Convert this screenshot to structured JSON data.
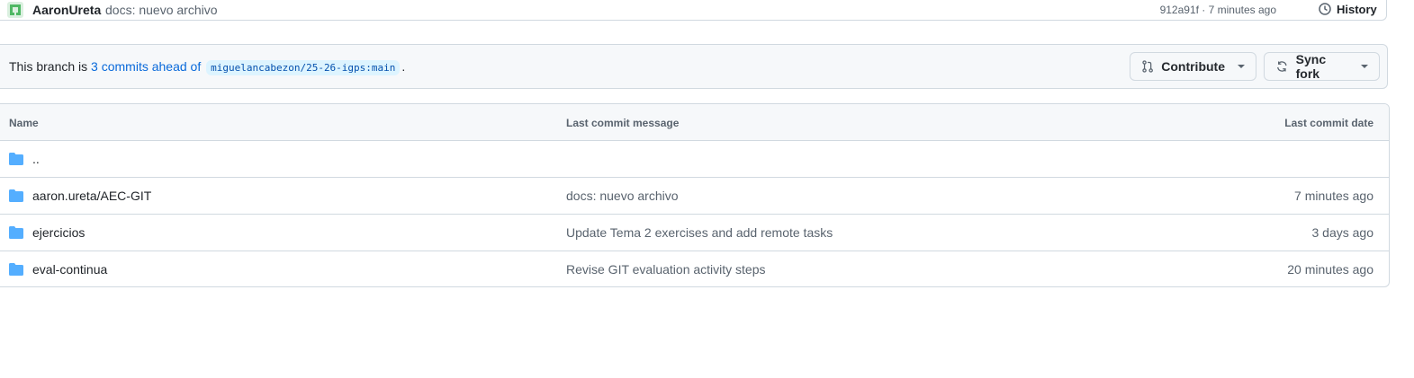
{
  "commit": {
    "author": "AaronUreta",
    "message": "docs: nuevo archivo",
    "meta": "912a91f · 7 minutes ago",
    "history_label": "History"
  },
  "branch": {
    "prefix": "This branch is",
    "ahead_link": "3 commits ahead of",
    "ref": "miguelancabezon/25-26-igps:main",
    "suffix": ".",
    "contribute_label": "Contribute",
    "sync_label": "Sync fork"
  },
  "table": {
    "headers": {
      "name": "Name",
      "message": "Last commit message",
      "date": "Last commit date"
    },
    "rows": [
      {
        "name": "..",
        "message": "",
        "date": ""
      },
      {
        "name": "aaron.ureta/AEC-GIT",
        "message": "docs: nuevo archivo",
        "date": "7 minutes ago"
      },
      {
        "name": "ejercicios",
        "message": "Update Tema 2 exercises and add remote tasks",
        "date": "3 days ago"
      },
      {
        "name": "eval-continua",
        "message": "Revise GIT evaluation activity steps",
        "date": "20 minutes ago"
      }
    ]
  },
  "colors": {
    "accent": "#0969da",
    "folder": "#54aeff",
    "border": "#d1d9e0",
    "muted": "#59636e"
  }
}
